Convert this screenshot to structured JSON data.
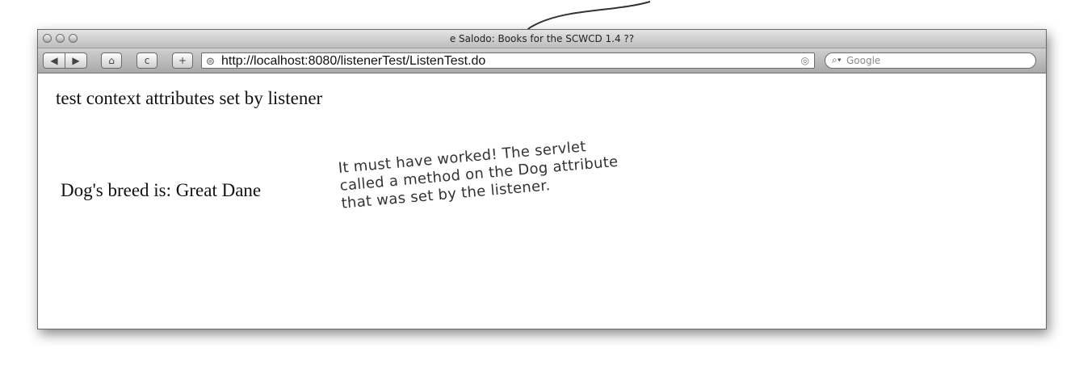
{
  "window": {
    "title": "e Salodo: Books for the SCWCD 1.4 ??"
  },
  "toolbar": {
    "back_label": "◀",
    "forward_label": "▶",
    "home_label": "⌂",
    "reload_label": "c",
    "add_label": "+",
    "url": "http://localhost:8080/listenerTest/ListenTest.do",
    "search_placeholder": "Google"
  },
  "page": {
    "heading": "test context attributes set by listener",
    "breed_text": "Dog's breed is: Great Dane"
  },
  "annotation": {
    "lines": [
      "It must have worked! The servlet",
      "called a method on the Dog attribute",
      "that was set by the listener."
    ]
  }
}
